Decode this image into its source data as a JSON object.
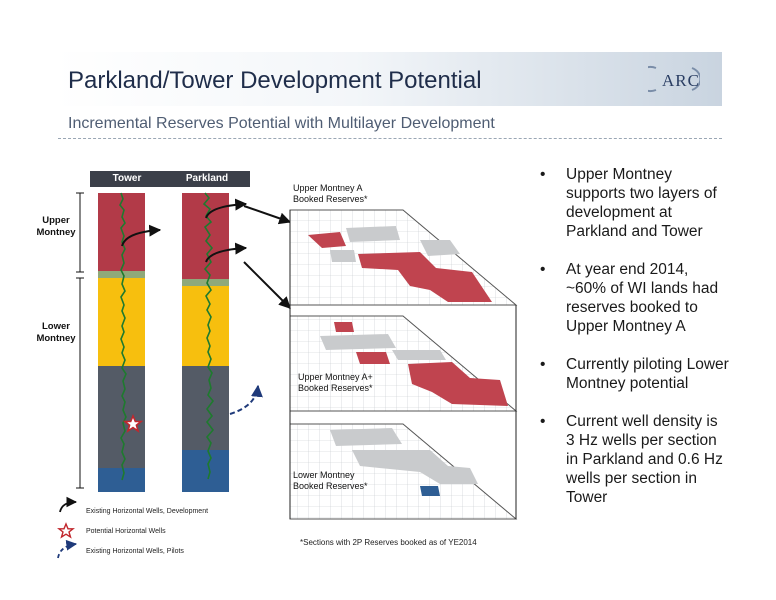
{
  "header": {
    "title": "Parkland/Tower Development Potential",
    "subtitle": "Incremental Reserves Potential with Multilayer Development",
    "logo_text": "ARC"
  },
  "columns": [
    "Tower",
    "Parkland"
  ],
  "zones": [
    "Upper\nMontney",
    "Lower\nMontney"
  ],
  "map_labels": [
    "Upper Montney A\nBooked Reserves*",
    "Upper Montney A+\nBooked Reserves*",
    "Lower Montney\nBooked Reserves*"
  ],
  "legend": [
    "Existing Horizontal Wells, Development",
    "Potential Horizontal Wells",
    "Existing Horizontal Wells, Pilots"
  ],
  "footnote": "*Sections with 2P Reserves booked as of YE2014",
  "bullets": [
    "Upper Montney supports two layers of development at Parkland and Tower",
    "At year end 2014, ~60% of WI lands had reserves booked to Upper Montney A",
    "Currently piloting Lower Montney potential",
    "Current well density is 3 Hz wells per section in Parkland and 0.6 Hz wells per section in Tower"
  ],
  "colors": {
    "upper_montney": "#b23a48",
    "lower_montney_a": "#f7bf0e",
    "lower_montney_b": "#545b66",
    "basal": "#2e5e94",
    "reserves": "#c0444f",
    "header_bar": "#3b3f49"
  }
}
